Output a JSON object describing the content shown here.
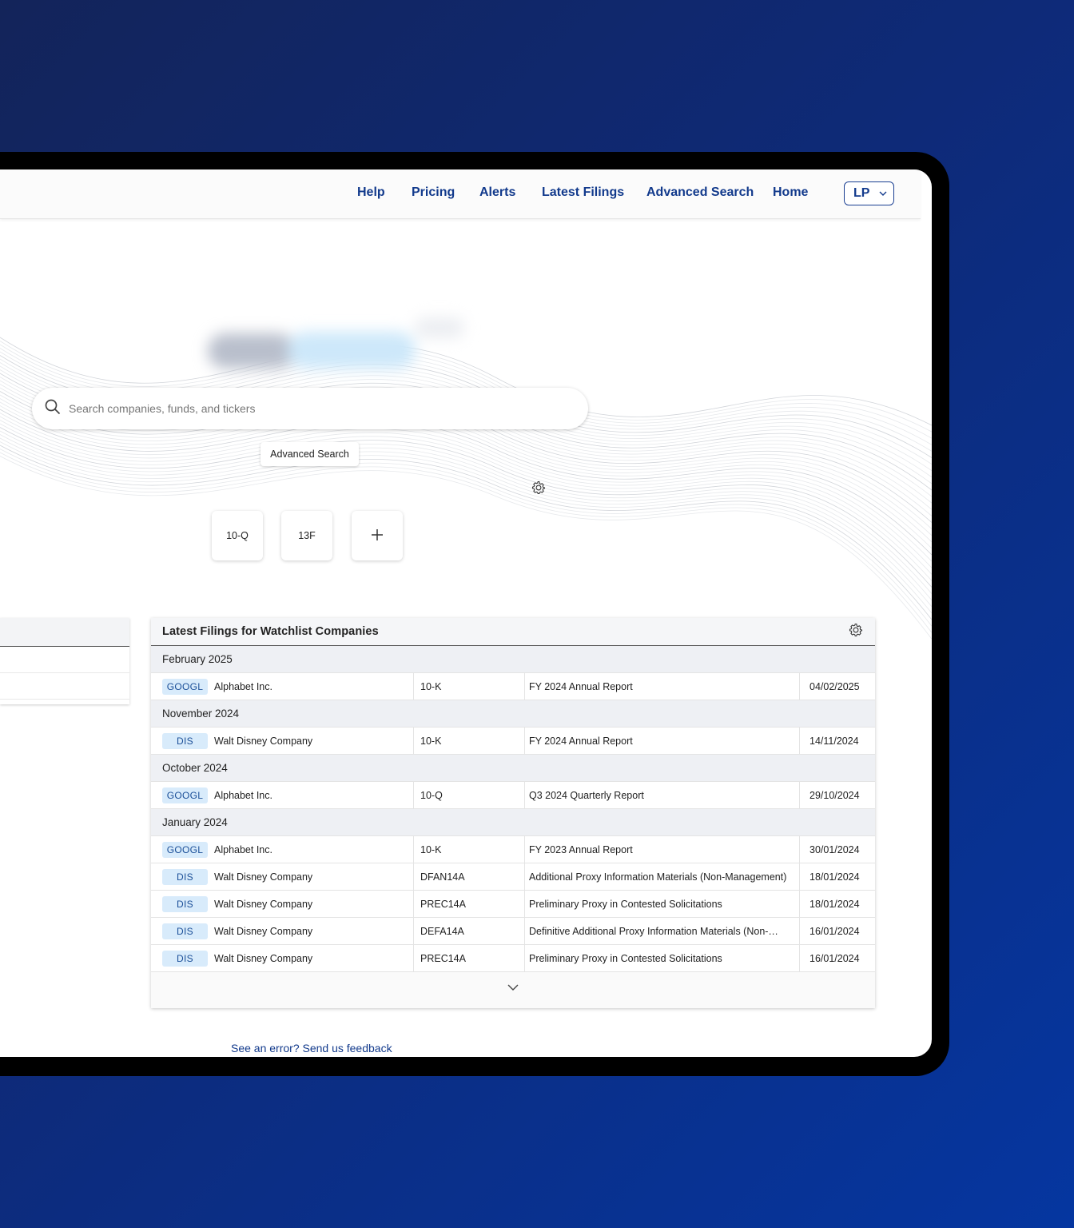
{
  "nav": {
    "links": [
      {
        "label": "Help"
      },
      {
        "label": "Pricing"
      },
      {
        "label": "Alerts"
      },
      {
        "label": "Latest Filings"
      },
      {
        "label": "Advanced Search"
      },
      {
        "label": "Home"
      }
    ],
    "user_initials": "LP"
  },
  "search": {
    "placeholder": "Search companies, funds, and tickers",
    "advanced_label": "Advanced Search"
  },
  "quick_filings": [
    "10-Q",
    "13F"
  ],
  "filings_panel": {
    "title": "Latest Filings for Watchlist Companies",
    "groups": [
      {
        "month": "February 2025",
        "rows": [
          {
            "ticker": "GOOGL",
            "company": "Alphabet Inc.",
            "form": "10-K",
            "description": "FY 2024 Annual Report",
            "date": "04/02/2025"
          }
        ]
      },
      {
        "month": "November 2024",
        "rows": [
          {
            "ticker": "DIS",
            "company": "Walt Disney Company",
            "form": "10-K",
            "description": "FY 2024 Annual Report",
            "date": "14/11/2024"
          }
        ]
      },
      {
        "month": "October 2024",
        "rows": [
          {
            "ticker": "GOOGL",
            "company": "Alphabet Inc.",
            "form": "10-Q",
            "description": "Q3 2024 Quarterly Report",
            "date": "29/10/2024"
          }
        ]
      },
      {
        "month": "January 2024",
        "rows": [
          {
            "ticker": "GOOGL",
            "company": "Alphabet Inc.",
            "form": "10-K",
            "description": "FY 2023 Annual Report",
            "date": "30/01/2024"
          },
          {
            "ticker": "DIS",
            "company": "Walt Disney Company",
            "form": "DFAN14A",
            "description": "Additional Proxy Information Materials (Non-Management)",
            "date": "18/01/2024"
          },
          {
            "ticker": "DIS",
            "company": "Walt Disney Company",
            "form": "PREC14A",
            "description": "Preliminary Proxy in Contested Solicitations",
            "date": "18/01/2024"
          },
          {
            "ticker": "DIS",
            "company": "Walt Disney Company",
            "form": "DEFA14A",
            "description": "Definitive Additional Proxy Information Materials (Non-…",
            "date": "16/01/2024"
          },
          {
            "ticker": "DIS",
            "company": "Walt Disney Company",
            "form": "PREC14A",
            "description": "Preliminary Proxy in Contested Solicitations",
            "date": "16/01/2024"
          }
        ]
      }
    ]
  },
  "footer": {
    "feedback": "See an error? Send us feedback"
  },
  "colors": {
    "accent": "#123a8c",
    "ticker_bg": "#d8ebfb",
    "ticker_text": "#1b4f98",
    "background_start": "#13245a",
    "background_end": "#0536a0"
  }
}
